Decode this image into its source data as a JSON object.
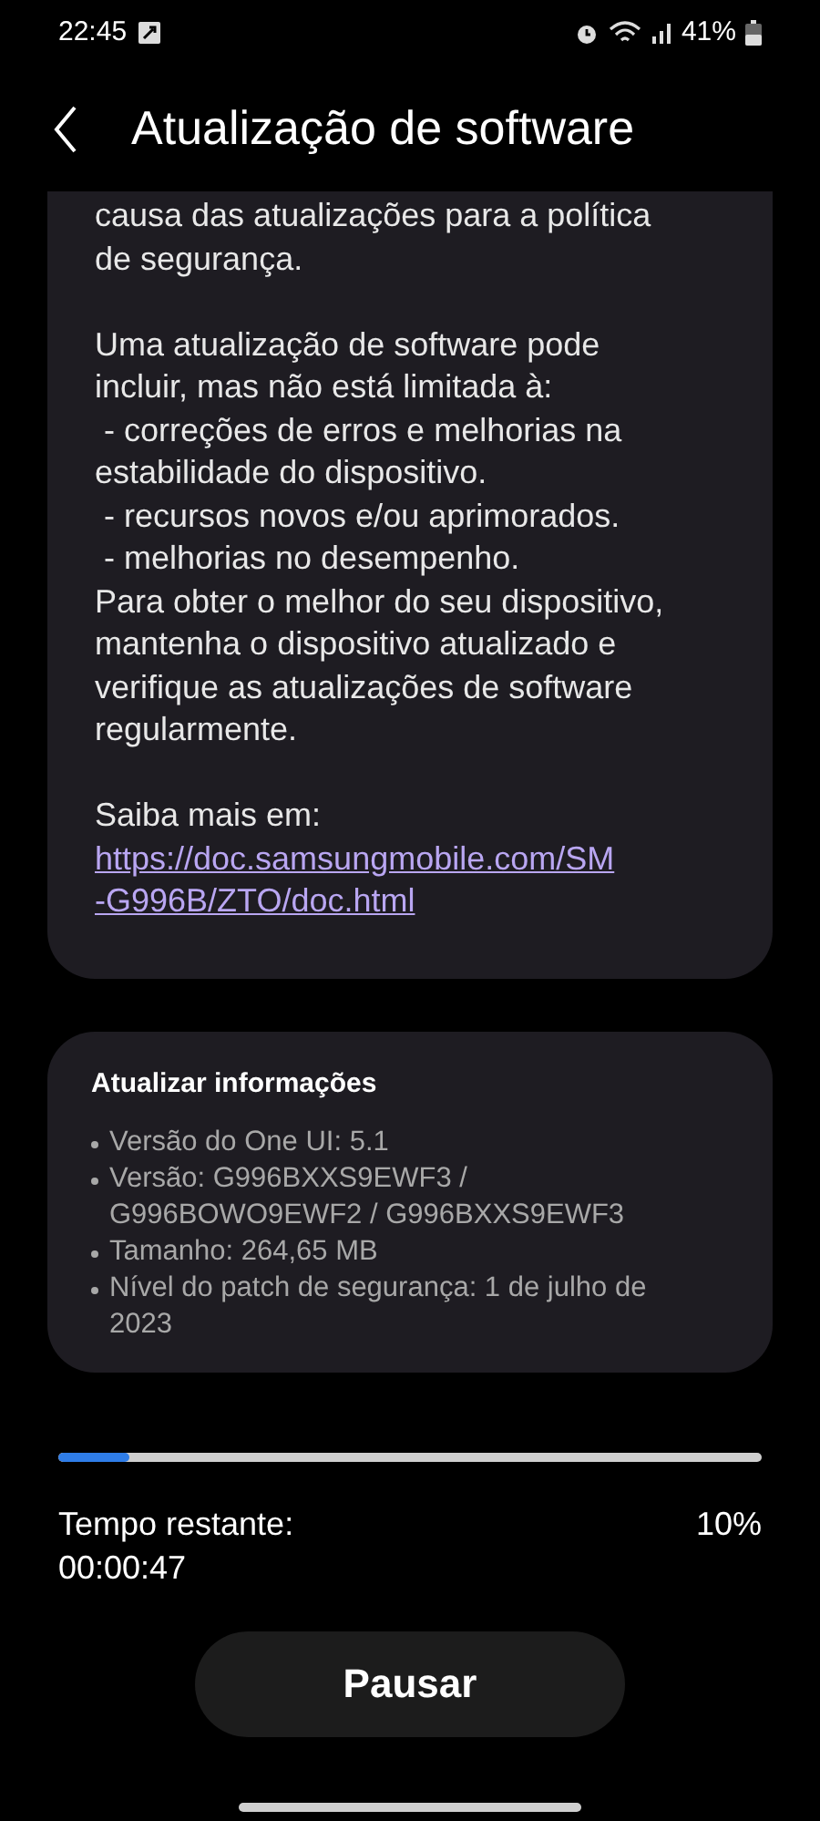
{
  "status_bar": {
    "time": "22:45",
    "battery": "41%"
  },
  "header": {
    "title": "Atualização de software"
  },
  "notes_card": {
    "lines": [
      {
        "kind": "text",
        "text": "causa das atualizações para a política"
      },
      {
        "kind": "text",
        "text": "de segurança."
      },
      {
        "kind": "gap"
      },
      {
        "kind": "text",
        "text": "Uma atualização de software pode"
      },
      {
        "kind": "text",
        "text": "incluir, mas não está limitada à:"
      },
      {
        "kind": "text",
        "text": " - correções de erros e melhorias na"
      },
      {
        "kind": "text",
        "text": "estabilidade do dispositivo."
      },
      {
        "kind": "text",
        "text": " - recursos novos e/ou aprimorados."
      },
      {
        "kind": "text",
        "text": " - melhorias no desempenho."
      },
      {
        "kind": "text",
        "text": "Para obter o melhor do seu dispositivo,"
      },
      {
        "kind": "text",
        "text": "mantenha o dispositivo atualizado e"
      },
      {
        "kind": "text",
        "text": "verifique as atualizações de software"
      },
      {
        "kind": "text",
        "text": "regularmente."
      },
      {
        "kind": "gap"
      },
      {
        "kind": "text",
        "text": "Saiba mais em:"
      },
      {
        "kind": "link",
        "text": "https://doc.samsungmobile.com/SM"
      },
      {
        "kind": "link",
        "text": "-G996B/ZTO/doc.html"
      }
    ]
  },
  "info_card": {
    "title": "Atualizar informações",
    "items": [
      "Versão do One UI: 5.1",
      "Versão: G996BXXS9EWF3 / G996BOWO9EWF2 / G996BXXS9EWF3",
      "Tamanho: 264,65 MB",
      "Nível do patch de segurança: 1 de julho de 2023"
    ]
  },
  "progress": {
    "level": 0.1,
    "label": "Tempo restante:",
    "time": "00:00:47",
    "percent": "10%"
  },
  "pause_button": "Pausar"
}
